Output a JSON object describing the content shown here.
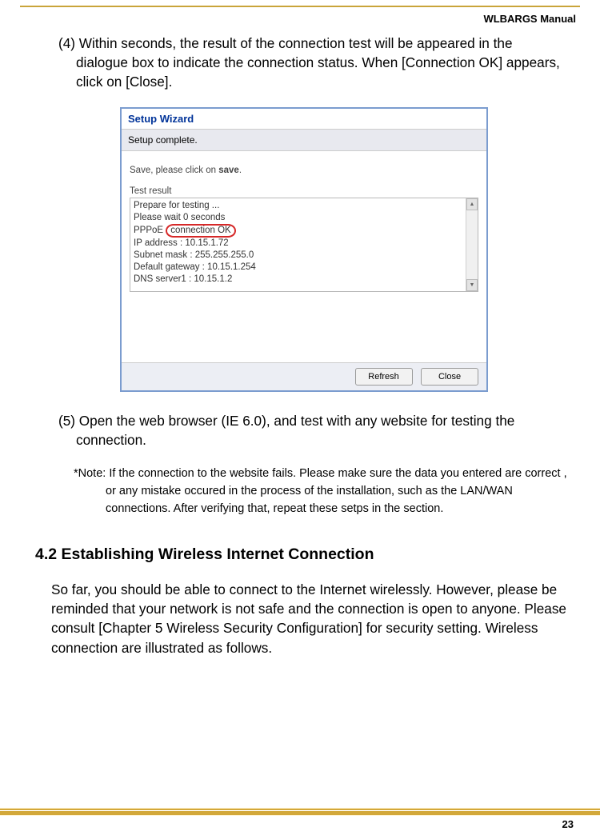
{
  "header": {
    "title": "WLBARGS Manual"
  },
  "step4": {
    "prefix": "(4) ",
    "text": "Within seconds, the result of the connection test will be appeared in the dialogue box to indicate the connection status. When [Connection OK] appears, click on [Close]."
  },
  "dialog": {
    "title": "Setup Wizard",
    "subtitle": "Setup complete.",
    "save_prefix": "Save, please click on ",
    "save_bold": "save",
    "save_suffix": ".",
    "test_label": "Test result",
    "results": [
      "Prepare for testing ...",
      "Please wait 0 seconds",
      "PPPoE ",
      "IP address : 10.15.1.72",
      "Subnet mask : 255.255.255.0",
      "Default gateway : 10.15.1.254",
      "DNS server1 : 10.15.1.2"
    ],
    "highlight_text": "connection OK",
    "btn_refresh": "Refresh",
    "btn_close": "Close"
  },
  "step5": {
    "prefix": "(5) ",
    "text": "Open the web browser (IE 6.0), and test with any website for testing the connection."
  },
  "note": {
    "label": "*Note: ",
    "text": "If the connection to the website fails. Please make sure the data you entered are correct , or any mistake occured in the process of the installation, such as the LAN/WAN connections. After verifying that, repeat these setps in the section."
  },
  "section": {
    "heading": "4.2 Establishing Wireless Internet Connection",
    "body": "So far, you should be able to connect to the Internet wirelessly. However, please be reminded that your network is not safe and the connection is open to anyone. Please consult [Chapter 5 Wireless Security Configuration] for security setting. Wireless connection are illustrated as follows."
  },
  "chart_data": {
    "type": "table",
    "title": "Setup Wizard — Test result",
    "rows": [
      {
        "field": "Status",
        "value": "Prepare for testing ..."
      },
      {
        "field": "Wait",
        "value": "Please wait 0 seconds"
      },
      {
        "field": "PPPoE",
        "value": "connection OK"
      },
      {
        "field": "IP address",
        "value": "10.15.1.72"
      },
      {
        "field": "Subnet mask",
        "value": "255.255.255.0"
      },
      {
        "field": "Default gateway",
        "value": "10.15.1.254"
      },
      {
        "field": "DNS server1",
        "value": "10.15.1.2"
      }
    ]
  },
  "page_number": "23"
}
